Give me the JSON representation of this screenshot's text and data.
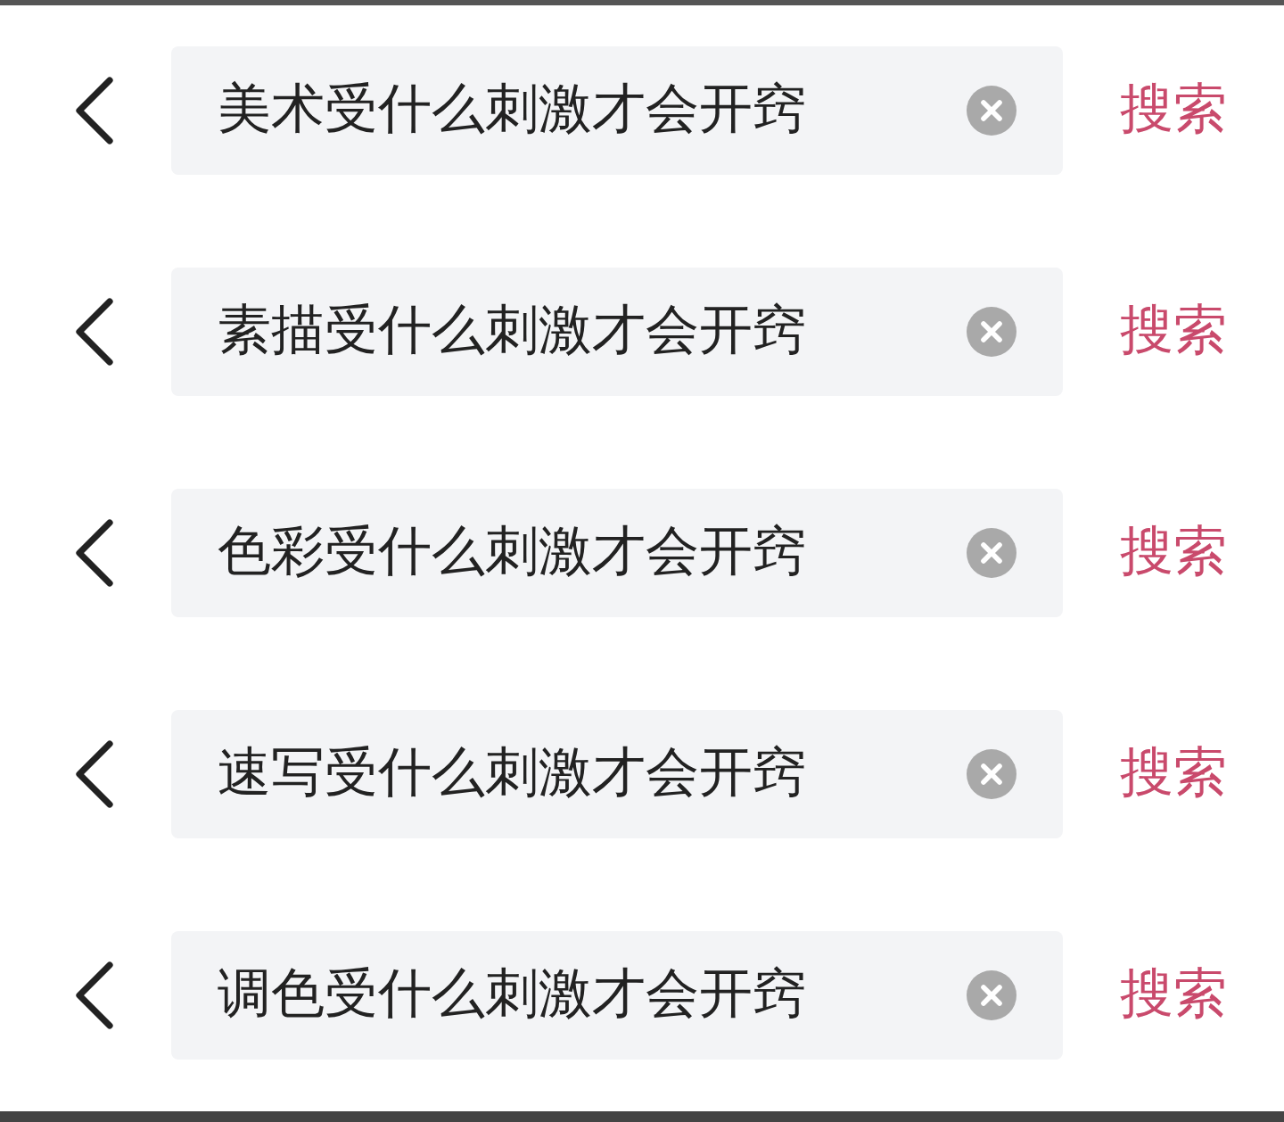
{
  "rows": [
    {
      "query": "美术受什么刺激才会开窍",
      "action": "搜索"
    },
    {
      "query": "素描受什么刺激才会开窍",
      "action": "搜索"
    },
    {
      "query": "色彩受什么刺激才会开窍",
      "action": "搜索"
    },
    {
      "query": "速写受什么刺激才会开窍",
      "action": "搜索"
    },
    {
      "query": "调色受什么刺激才会开窍",
      "action": "搜索"
    }
  ]
}
